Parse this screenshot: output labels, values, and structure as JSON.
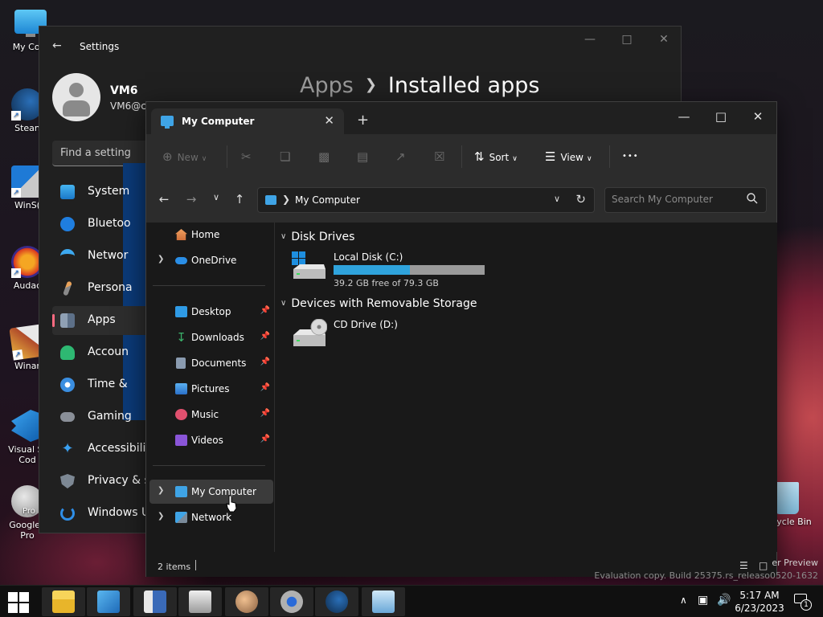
{
  "colors": {
    "accent": "#3fa4e6",
    "drive_fill": "#2fa3dc",
    "settings_active_indicator": "#ff6b81"
  },
  "desktop_icons": [
    {
      "label": "My Com",
      "icon": "monitor-icon"
    },
    {
      "label": "Stean",
      "icon": "steam-icon"
    },
    {
      "label": "WinS(",
      "icon": "lock-icon"
    },
    {
      "label": "Audac",
      "icon": "audacity-icon"
    },
    {
      "label": "Winar",
      "icon": "winrar-icon"
    },
    {
      "label": "Visual St",
      "label2": "Cod",
      "icon": "vscode-icon"
    },
    {
      "label": "Google I",
      "label2": "Pro",
      "icon": "globe-icon",
      "badge": "Pro"
    }
  ],
  "recycle_bin": {
    "label": "ycle Bin"
  },
  "settings": {
    "title": "Settings",
    "user_name": "VM6",
    "user_email": "VM6@cc",
    "find_placeholder": "Find a setting",
    "breadcrumb_parent": "Apps",
    "breadcrumb_current": "Installed apps",
    "nav": [
      {
        "label": "System",
        "icon": "system-icon"
      },
      {
        "label": "Bluetoo",
        "icon": "bluetooth-icon"
      },
      {
        "label": "Networ",
        "icon": "wifi-icon"
      },
      {
        "label": "Persona",
        "icon": "brush-icon"
      },
      {
        "label": "Apps",
        "icon": "apps-icon",
        "active": true
      },
      {
        "label": "Accoun",
        "icon": "account-icon"
      },
      {
        "label": "Time &",
        "icon": "clock-icon"
      },
      {
        "label": "Gaming",
        "icon": "gamepad-icon"
      },
      {
        "label": "Accessibility",
        "icon": "accessibility-icon"
      },
      {
        "label": "Privacy & se",
        "icon": "shield-icon"
      },
      {
        "label": "Windows Up",
        "icon": "update-icon"
      }
    ]
  },
  "explorer": {
    "tab_title": "My Computer",
    "toolbar": {
      "new": "New",
      "sort": "Sort",
      "view": "View",
      "more": "•••"
    },
    "address": "My Computer",
    "search_placeholder": "Search My Computer",
    "nav": {
      "home": "Home",
      "onedrive": "OneDrive",
      "quick_access": [
        {
          "label": "Desktop",
          "icon": "desktop-icon",
          "color": "#2f9be6"
        },
        {
          "label": "Downloads",
          "icon": "download-icon",
          "color": "#3bb36b"
        },
        {
          "label": "Documents",
          "icon": "documents-icon",
          "color": "#8a9bb0"
        },
        {
          "label": "Pictures",
          "icon": "pictures-icon",
          "color": "#3d8de0"
        },
        {
          "label": "Music",
          "icon": "music-icon",
          "color": "#e0506e"
        },
        {
          "label": "Videos",
          "icon": "videos-icon",
          "color": "#8a55d8"
        }
      ],
      "my_computer": "My Computer",
      "network": "Network"
    },
    "groups": {
      "disk_drives": "Disk Drives",
      "removable": "Devices with Removable Storage"
    },
    "drives": {
      "c_name": "Local Disk (C:)",
      "c_free": "39.2 GB free of 79.3 GB",
      "c_used_fraction": 0.506,
      "d_name": "CD Drive (D:)"
    },
    "status": {
      "count": "2 items"
    }
  },
  "watermark": {
    "line1": "er Preview",
    "line2": "Evaluation copy. Build 25375.rs_releaso0520-1632"
  },
  "taskbar": {
    "time": "5:17 AM",
    "date": "6/23/2023",
    "notification_count": "1"
  }
}
